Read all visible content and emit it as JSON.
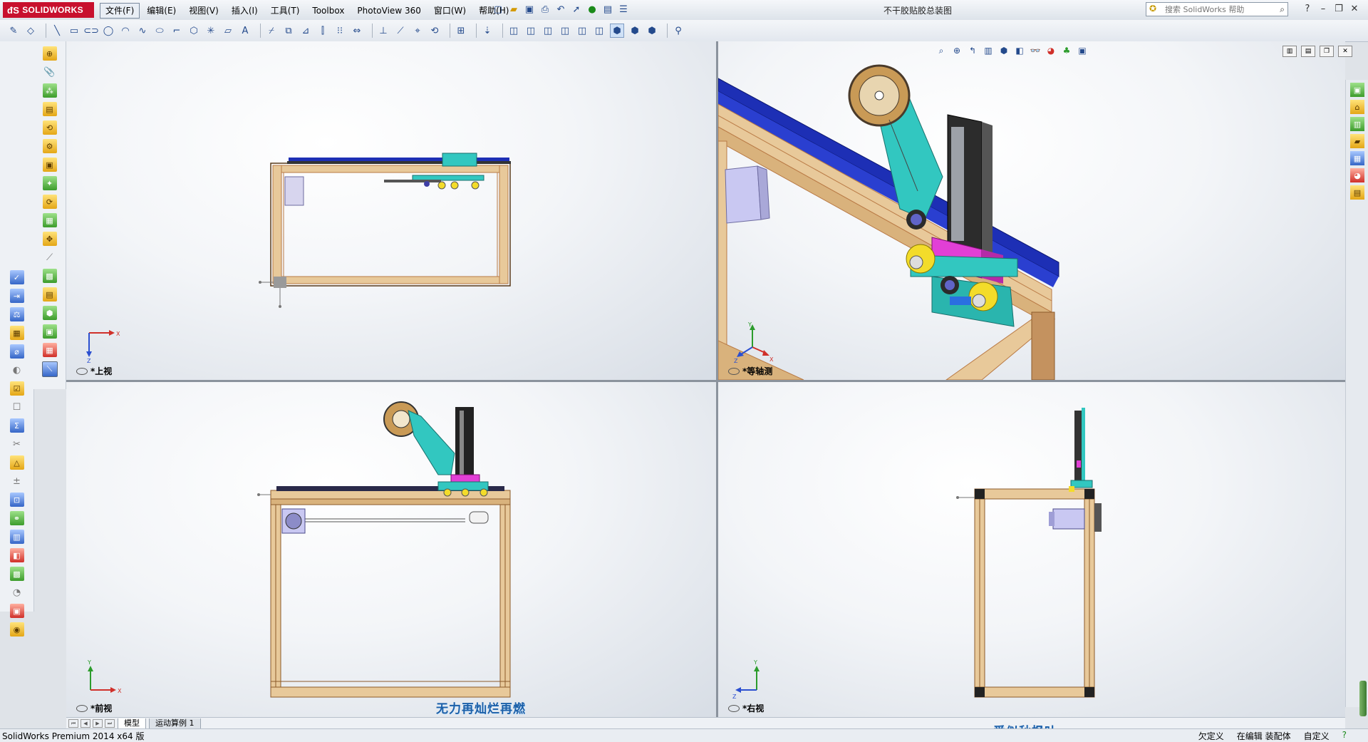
{
  "app": {
    "logo": "SOLIDWORKS",
    "document_title": "不干胶贴胶总装图"
  },
  "menus": [
    {
      "label": "文件(F)"
    },
    {
      "label": "编辑(E)"
    },
    {
      "label": "视图(V)"
    },
    {
      "label": "插入(I)"
    },
    {
      "label": "工具(T)"
    },
    {
      "label": "Toolbox"
    },
    {
      "label": "PhotoView 360"
    },
    {
      "label": "窗口(W)"
    },
    {
      "label": "帮助(H)"
    }
  ],
  "help_search": {
    "placeholder": "搜索 SolidWorks 帮助"
  },
  "viewports": {
    "top": {
      "label": "*上视"
    },
    "iso": {
      "label": "*等轴测"
    },
    "front": {
      "label": "*前视"
    },
    "right": {
      "label": "*右视"
    }
  },
  "bottom_tabs": [
    {
      "label": "模型"
    },
    {
      "label": "运动算例 1"
    }
  ],
  "status": {
    "app_version": "SolidWorks Premium 2014 x64 版",
    "underdefined": "欠定义",
    "editing": "在编辑 装配体",
    "custom": "自定义"
  },
  "watermarks": {
    "left": "无力再灿烂再燃",
    "right": "爱似秋枫叶"
  },
  "icons": {
    "help": "help-icon",
    "search": "magnifier-icon",
    "minimize": "minimize-icon",
    "restore": "restore-icon",
    "close": "close-icon"
  },
  "colors": {
    "profile_wood": "#e8c99a",
    "profile_edge": "#b97a45",
    "rail_blue": "#1d2fb5",
    "arm_teal": "#32c7c0",
    "block_magenta": "#e23fd6",
    "bearing_yellow": "#f3dc2a",
    "motor_lilac": "#c9c8f2",
    "axis_x": "#d0302a",
    "axis_y": "#2c9c2c",
    "axis_z": "#2b4fd0"
  }
}
